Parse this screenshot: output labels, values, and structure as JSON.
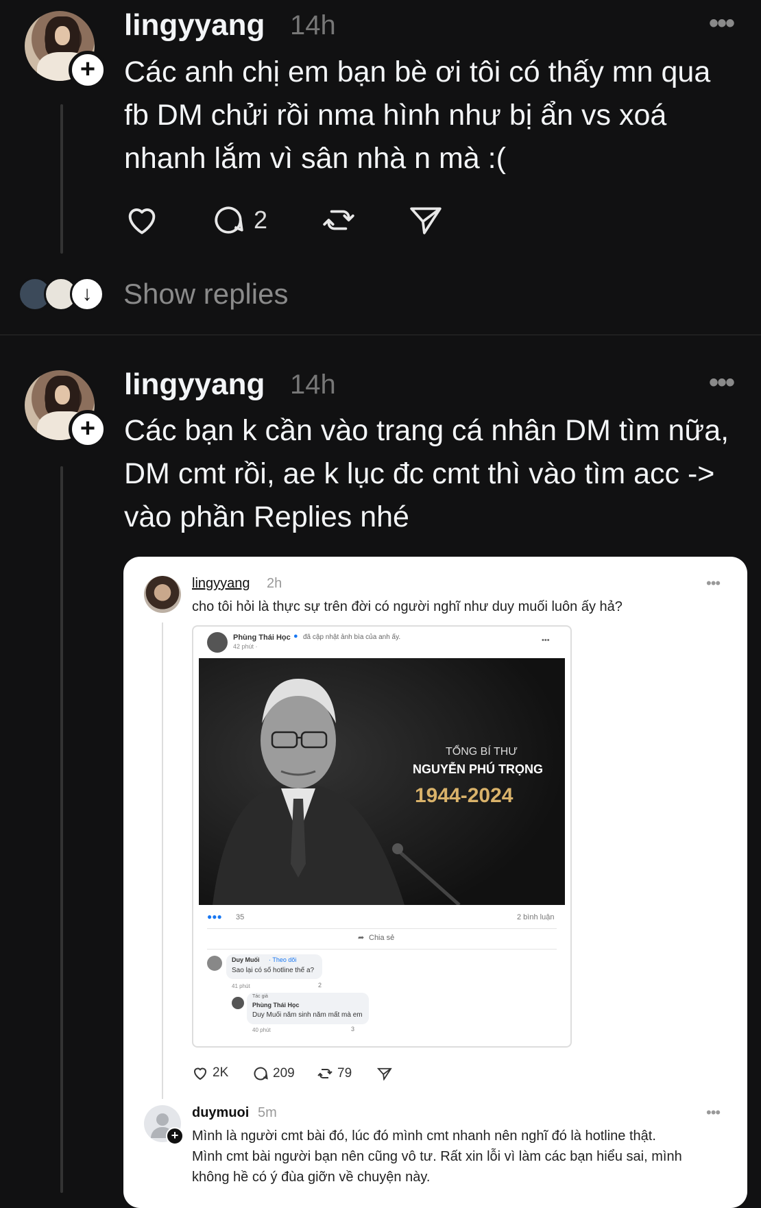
{
  "posts": [
    {
      "username": "lingyyang",
      "time": "14h",
      "text": "Các anh chị em bạn bè ơi tôi có thấy mn qua fb DM chửi rồi nma hình như bị ẩn vs xoá nhanh lắm vì sân nhà n mà :(",
      "comment_count": "2"
    },
    {
      "username": "lingyyang",
      "time": "14h",
      "text": "Các bạn k cần vào trang cá nhân DM tìm nữa, DM cmt rồi, ae k lục đc cmt thì vào tìm acc -> vào phần Replies nhé"
    }
  ],
  "show_replies": "Show replies",
  "embedded": {
    "post": {
      "username": "lingyyang",
      "time": "2h",
      "text": "cho tôi hỏi là thực sự trên đời có người nghĩ như duy muối luôn ấy hả?",
      "likes": "2K",
      "comments": "209",
      "reposts": "79"
    },
    "fb": {
      "author": "Phùng Thái Học",
      "action": "đã cập nhật ảnh bìa của anh ấy.",
      "posted": "42 phút ·",
      "photo_line1": "TỔNG BÍ THƯ",
      "photo_line2": "NGUYỄN PHÚ TRỌNG",
      "photo_years": "1944-2024",
      "reactions": "35",
      "comment_count": "2 bình luận",
      "share": "Chia sẻ",
      "comment1_name": "Duy Muối",
      "comment1_follow": "· Theo dõi",
      "comment1_text": "Sao lại có số hotline thế a?",
      "comment1_time": "41 phút",
      "comment1_react": "2",
      "reply_badge": "Tác giả",
      "reply_name": "Phùng Thái Học",
      "reply_text": "Duy Muối năm sinh năm mất mà em",
      "reply_time": "40 phút",
      "reply_react": "3"
    },
    "reply": {
      "username": "duymuoi",
      "time": "5m",
      "text_lines": [
        "Mình là người cmt bài đó, lúc đó mình cmt nhanh nên nghĩ đó là hotline thật.",
        "Mình cmt bài người bạn nên cũng vô tư. Rất xin lỗi vì làm các bạn hiểu sai, mình",
        "không hề có ý đùa giỡn về chuyện này."
      ]
    }
  },
  "icons": [
    "heart-icon",
    "comment-icon",
    "repost-icon",
    "share-icon",
    "more-icon",
    "plus-icon",
    "arrow-down-icon"
  ]
}
